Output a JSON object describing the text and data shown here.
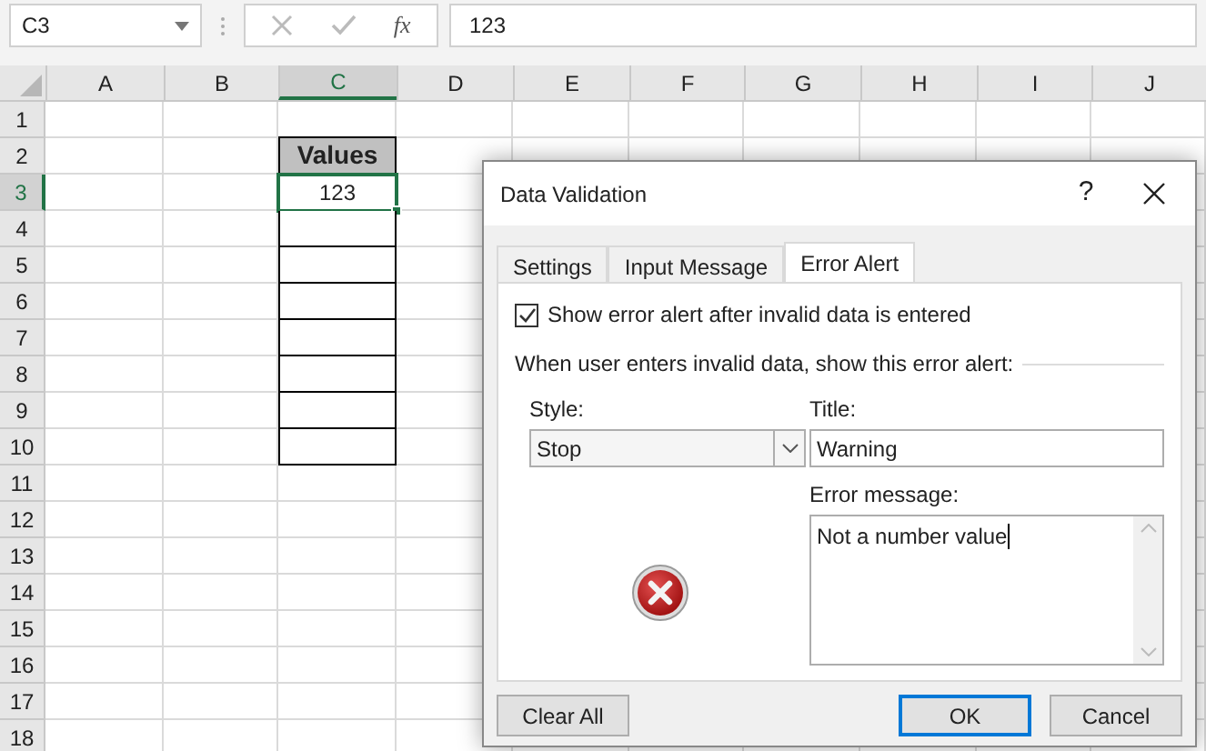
{
  "formula_bar": {
    "name_box": "C3",
    "function_label": "fx",
    "formula": "123"
  },
  "columns": [
    {
      "label": "A",
      "selected": false
    },
    {
      "label": "B",
      "selected": false
    },
    {
      "label": "C",
      "selected": true
    },
    {
      "label": "D",
      "selected": false
    },
    {
      "label": "E",
      "selected": false
    },
    {
      "label": "F",
      "selected": false
    },
    {
      "label": "G",
      "selected": false
    },
    {
      "label": "H",
      "selected": false
    },
    {
      "label": "I",
      "selected": false
    },
    {
      "label": "J",
      "selected": false
    }
  ],
  "rows": [
    {
      "label": "1",
      "selected": false
    },
    {
      "label": "2",
      "selected": false,
      "cell": {
        "kind": "header",
        "text": "Values"
      }
    },
    {
      "label": "3",
      "selected": true,
      "cell": {
        "kind": "value",
        "text": "123",
        "active": true
      }
    },
    {
      "label": "4",
      "selected": false,
      "cell": {
        "kind": "value"
      }
    },
    {
      "label": "5",
      "selected": false,
      "cell": {
        "kind": "value"
      }
    },
    {
      "label": "6",
      "selected": false,
      "cell": {
        "kind": "value"
      }
    },
    {
      "label": "7",
      "selected": false,
      "cell": {
        "kind": "value"
      }
    },
    {
      "label": "8",
      "selected": false,
      "cell": {
        "kind": "value"
      }
    },
    {
      "label": "9",
      "selected": false,
      "cell": {
        "kind": "value"
      }
    },
    {
      "label": "10",
      "selected": false,
      "cell": {
        "kind": "value"
      }
    },
    {
      "label": "11",
      "selected": false
    },
    {
      "label": "12",
      "selected": false
    },
    {
      "label": "13",
      "selected": false
    },
    {
      "label": "14",
      "selected": false
    },
    {
      "label": "15",
      "selected": false
    },
    {
      "label": "16",
      "selected": false
    },
    {
      "label": "17",
      "selected": false
    },
    {
      "label": "18",
      "selected": false
    }
  ],
  "dialog": {
    "title": "Data Validation",
    "help": "?",
    "tabs": [
      {
        "label": "Settings",
        "selected": false
      },
      {
        "label": "Input Message",
        "selected": false
      },
      {
        "label": "Error Alert",
        "selected": true
      }
    ],
    "show_alert": {
      "label": "Show error alert after invalid data is entered",
      "checked": true
    },
    "group_label": "When user enters invalid data, show this error alert:",
    "style": {
      "label": "Style:",
      "value": "Stop"
    },
    "title_field": {
      "label": "Title:",
      "value": "Warning"
    },
    "message_field": {
      "label": "Error message:",
      "value": "Not a number value"
    },
    "buttons": [
      {
        "label": "Clear All",
        "default": false
      },
      {
        "label": "OK",
        "default": true
      },
      {
        "label": "Cancel",
        "default": false
      }
    ]
  }
}
